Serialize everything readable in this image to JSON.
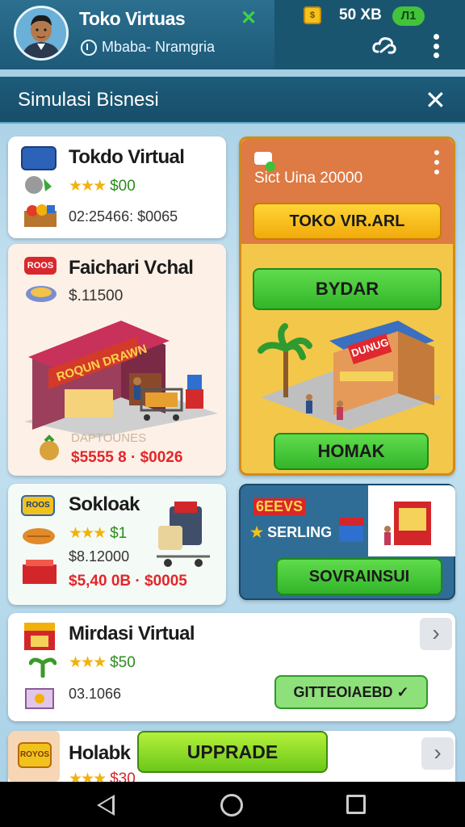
{
  "header": {
    "app_title": "Toko Virtuas",
    "subtitle": "Mbaba- Nramgria",
    "balance": "50 XB",
    "level": "Л1",
    "coin_glyph": "$"
  },
  "section": {
    "title": "Simulasi Bisnesi"
  },
  "cards": {
    "c1": {
      "title": "Tokdo Virtual",
      "stars": "★★★",
      "price": "$00",
      "meta": "02:25466: $0065"
    },
    "c2": {
      "title": "Faichari Vchal",
      "price": "$.11500",
      "sign_label": "ROQUN DRAWN",
      "box_label": "ROOS",
      "bottom_label": "DAPTOUNES",
      "red_meta": "$5555 8 · $0026"
    },
    "c3": {
      "header": "Sict Uina 20000",
      "button": "TOKO VIR.ARL"
    },
    "c4": {
      "top_button": "BYDAR",
      "shop_sign": "DUNUG",
      "bottom_button": "HOMAK"
    },
    "c5": {
      "title": "Sokloak",
      "stars": "★★★",
      "price": "$1",
      "meta": "$8.12000",
      "red_meta": "$5,40 0B · $0005",
      "box_label": "ROOS"
    },
    "c6": {
      "label1": "6EEVS",
      "label2": "SERLING",
      "button": "SOVRAINSUI"
    },
    "c7": {
      "title": "Mirdasi Virtual",
      "stars": "★★★",
      "price": "$50",
      "meta": "03.1066",
      "button": "GITTEOIAEBD ✓",
      "chevron": "›"
    },
    "c8": {
      "title": "Holabk",
      "stars": "★★★",
      "price": "$30",
      "chevron": "›",
      "box_label": "ROYOS"
    }
  },
  "upgrade": {
    "label": "UPPRADE"
  },
  "colors": {
    "accent_green": "#33b52a",
    "accent_yellow": "#f1ab0b",
    "header_blue": "#1c5a78"
  }
}
